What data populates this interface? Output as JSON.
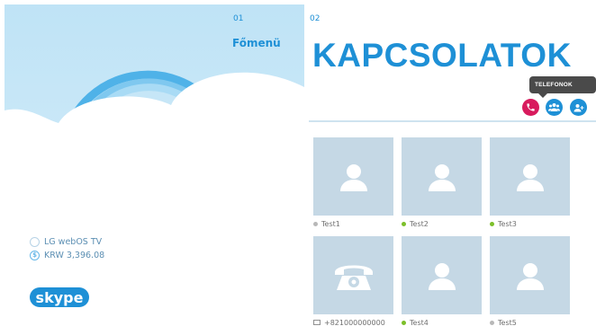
{
  "left": {
    "number": "01",
    "title": "Főmenü",
    "account_name": "LG webOS TV",
    "credit": "KRW 3,396.08",
    "logo_text": "skype"
  },
  "right": {
    "number": "02",
    "title": "KAPCSOLATOK",
    "tooltip": "TELEFONOK HÍVÁSA",
    "actions": [
      "call-phones",
      "group-call",
      "add-contact"
    ],
    "colors": {
      "accent": "#1e90d6",
      "call": "#d81b5d",
      "tile": "#c5d8e5",
      "online": "#7cbf2a",
      "offline": "#b8b8b8"
    }
  },
  "contacts": [
    {
      "name": "Test1",
      "status": "offline",
      "avatar": "person-icon"
    },
    {
      "name": "Test2",
      "status": "online",
      "avatar": "person-icon"
    },
    {
      "name": "Test3",
      "status": "online",
      "avatar": "person-icon"
    },
    {
      "name": "+821000000000",
      "status": "phone",
      "avatar": "telephone-icon"
    },
    {
      "name": "Test4",
      "status": "online",
      "avatar": "person-icon"
    },
    {
      "name": "Test5",
      "status": "offline",
      "avatar": "person-icon"
    }
  ]
}
